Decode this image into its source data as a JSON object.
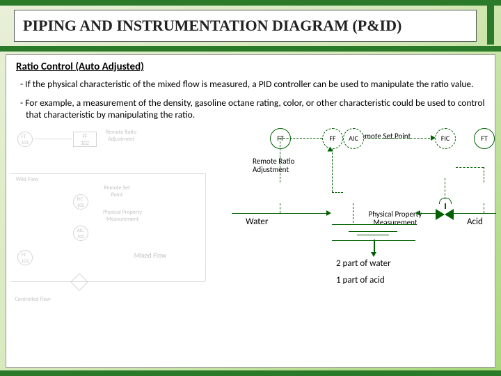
{
  "title": "PIPING AND INSTRUMENTATION DIAGRAM (P&ID)",
  "subtitle": "Ratio Control (Auto Adjusted)",
  "para1": "- If the physical characteristic of the mixed flow is measured, a PID controller can be used to manipulate the ratio value.",
  "para2": "- For example, a measurement of the density, gasoline octane rating, color, or other characteristic could be used to control that characteristic by manipulating the ratio.",
  "left": {
    "wild": "Wild Flow",
    "rra": "Remote Ratio Adjustment",
    "rsp": "Remote Set Point",
    "ppm": "Physical Property Measurement",
    "mf": "Mixed Flow",
    "cf": "Controlled Flow"
  },
  "right": {
    "ff": "FF",
    "rsp": "Remote Set Point",
    "rra": "Remote Ratio Adjustment",
    "fic": "FIC",
    "ft": "FT",
    "aic": "AIC",
    "water": "Water",
    "ppm": "Physical Property Measurement",
    "acid": "Acid",
    "r2": "2 part of water",
    "r1": "1 part of acid"
  }
}
